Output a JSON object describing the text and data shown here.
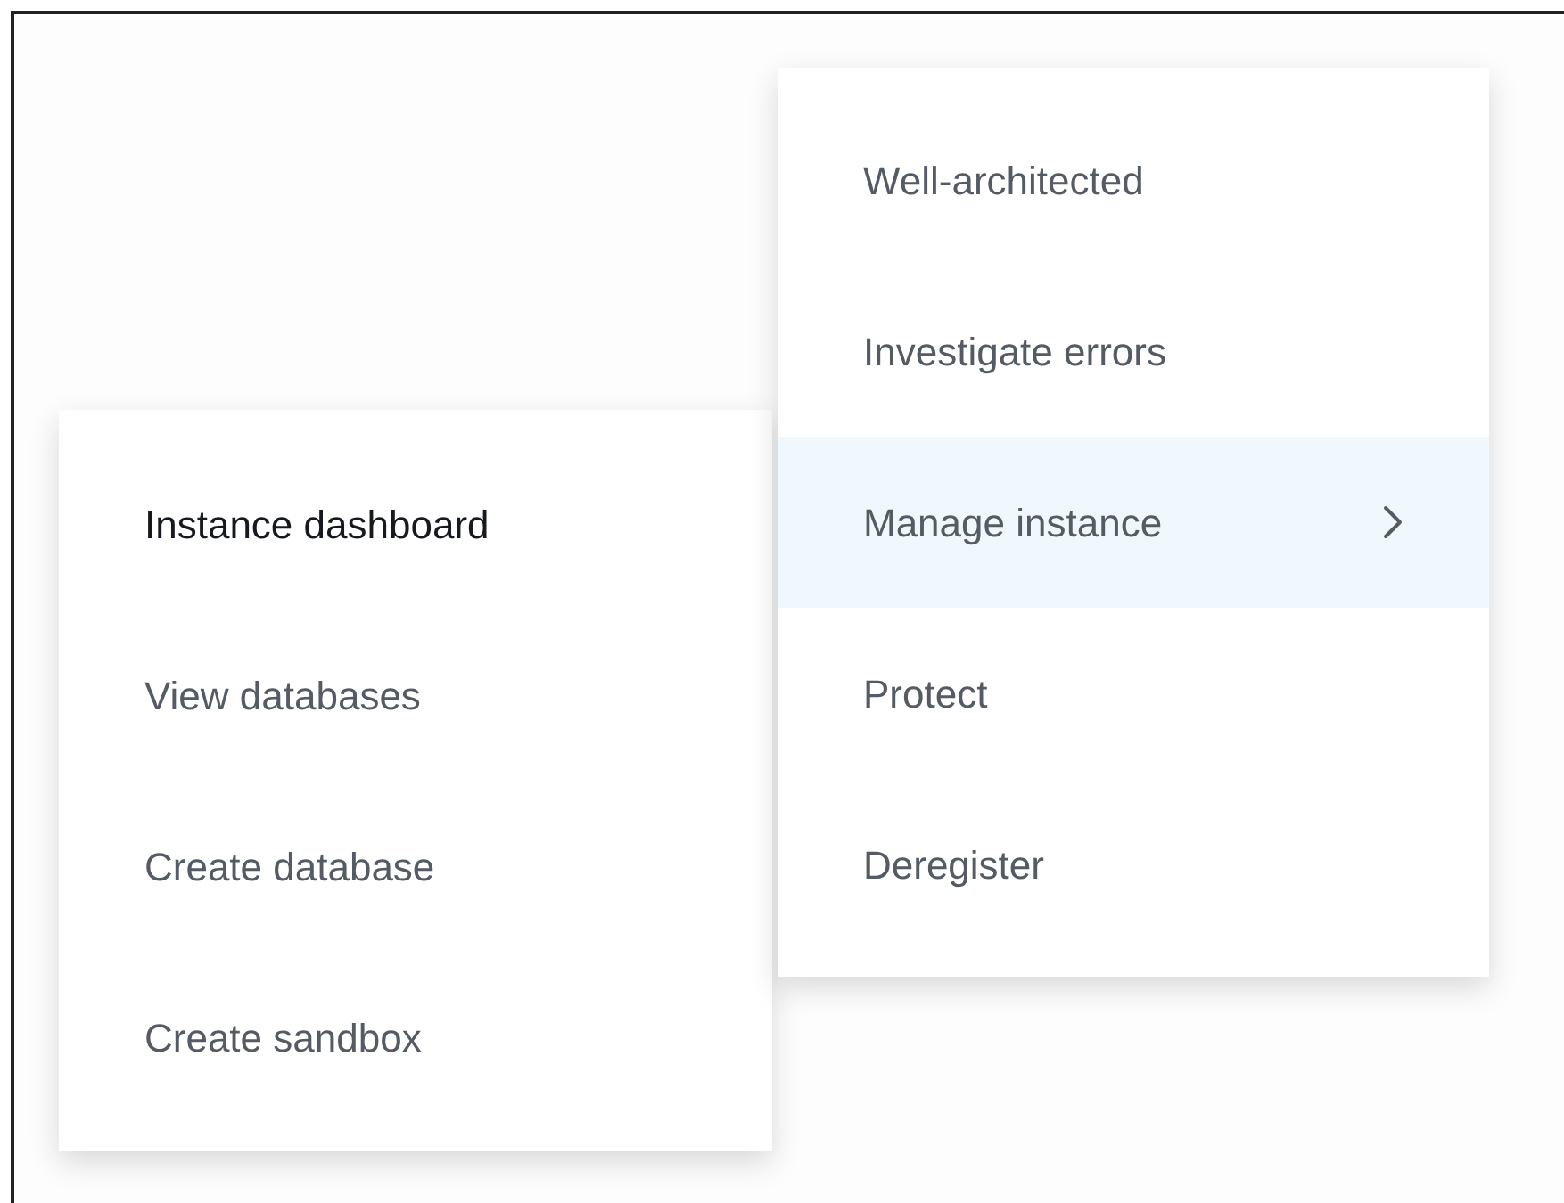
{
  "submenu": {
    "items": [
      {
        "label": "Instance dashboard",
        "selected": true
      },
      {
        "label": "View databases",
        "selected": false
      },
      {
        "label": "Create database",
        "selected": false
      },
      {
        "label": "Create sandbox",
        "selected": false
      }
    ]
  },
  "menu": {
    "items": [
      {
        "label": "Well-architected",
        "kind": "action",
        "selected": false
      },
      {
        "label": "Investigate errors",
        "kind": "action",
        "selected": false
      },
      {
        "label": "Manage instance",
        "kind": "submenu",
        "selected": true
      },
      {
        "label": "Protect",
        "kind": "action",
        "selected": false
      },
      {
        "label": "Deregister",
        "kind": "action",
        "selected": false
      }
    ]
  }
}
